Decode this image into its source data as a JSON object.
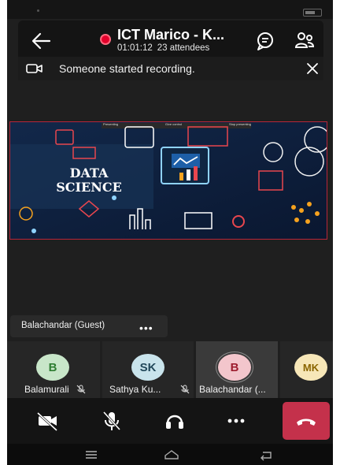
{
  "header": {
    "title": "ICT Marico - K...",
    "duration": "01:01:12",
    "attendees": "23 attendees",
    "colors": {
      "recording": "#e4002b"
    }
  },
  "banner": {
    "text": "Someone started recording."
  },
  "shared_content": {
    "title_line1": "DATA",
    "title_line2": "SCIENCE",
    "toolbar_labels": [
      "Presenting",
      "Give control",
      "Stop presenting"
    ]
  },
  "speaker_label": {
    "name": "Balachandar (Guest)",
    "more": "•••"
  },
  "participants": [
    {
      "initials": "B",
      "name": "Balamurali",
      "muted": true,
      "avatar_bg": "#c8e6c9",
      "avatar_fg": "#2e7d32"
    },
    {
      "initials": "SK",
      "name": "Sathya Ku...",
      "muted": true,
      "avatar_bg": "#c9e4ec",
      "avatar_fg": "#22485a"
    },
    {
      "initials": "B",
      "name": "Balachandar (...",
      "muted": false,
      "avatar_bg": "#f3c6cc",
      "avatar_fg": "#9d1d2e"
    },
    {
      "initials": "MK",
      "name": "",
      "muted": false,
      "avatar_bg": "#f7e7b8",
      "avatar_fg": "#8a6500"
    }
  ],
  "controls": {
    "icons": [
      "camera-off-icon",
      "mic-off-icon",
      "headset-icon",
      "more-icon",
      "hang-up-icon"
    ],
    "hangup_color": "#c4314b"
  }
}
